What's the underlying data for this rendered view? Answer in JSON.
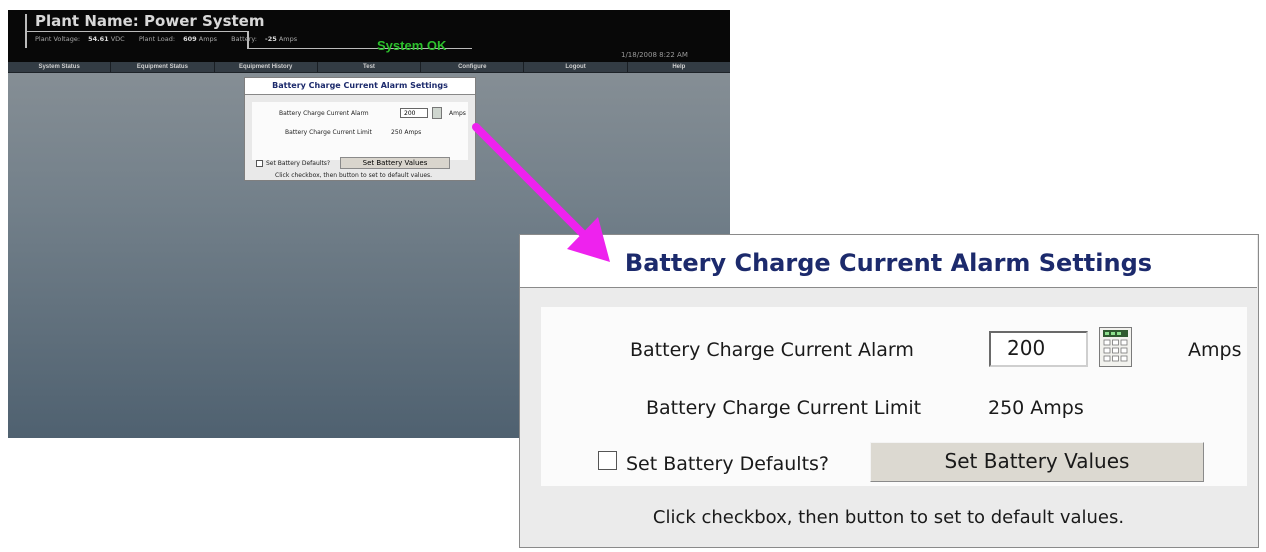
{
  "header": {
    "plant_label": "Plant Name:",
    "plant_name": "Power System",
    "voltage_label": "Plant Voltage:",
    "voltage_value": "54.61",
    "voltage_unit": "VDC",
    "load_label": "Plant Load:",
    "load_value": "609",
    "load_unit": "Amps",
    "battery_label": "Battery:",
    "battery_value": "-25",
    "battery_unit": "Amps",
    "system_status": "System OK",
    "datetime": "1/18/2008 8:22 AM"
  },
  "nav": {
    "items": [
      "System Status",
      "Equipment Status",
      "Equipment History",
      "Test",
      "Configure",
      "Logout",
      "Help"
    ]
  },
  "panel": {
    "title": "Battery Charge Current Alarm Settings",
    "alarm_label": "Battery Charge Current Alarm",
    "alarm_value": "200",
    "alarm_unit": "Amps",
    "limit_label": "Battery Charge Current Limit",
    "limit_value": "250 Amps",
    "defaults_label": "Set Battery Defaults?",
    "defaults_checked": false,
    "button_label": "Set Battery Values",
    "hint": "Click checkbox, then button to set to default values."
  },
  "colors": {
    "title_blue": "#1c2a6c",
    "status_green": "#2cc02c",
    "arrow_magenta": "#ee22ee"
  },
  "icons": [
    "keypad-icon",
    "checkbox-icon",
    "arrow-icon"
  ]
}
